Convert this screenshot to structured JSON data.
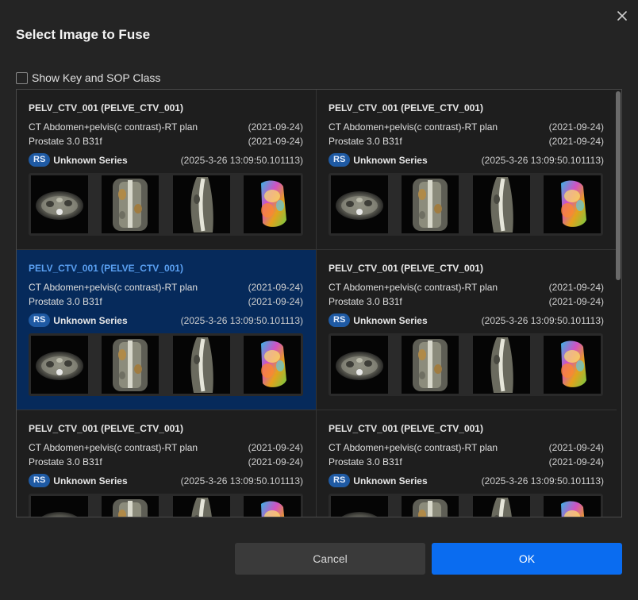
{
  "dialog": {
    "title": "Select Image to Fuse",
    "close_icon": "close-icon",
    "show_key_label": "Show Key and SOP Class",
    "show_key_checked": false
  },
  "cards": [
    {
      "title": "PELV_CTV_001 (PELVE_CTV_001)",
      "study": "CT Abdomen+pelvis(c contrast)-RT plan",
      "study_date": "(2021-09-24)",
      "series_desc": "Prostate 3.0 B31f",
      "series_date": "(2021-09-24)",
      "badge": "RS",
      "rs_series": "Unknown Series",
      "rs_date": "(2025-3-26 13:09:50.101113)",
      "selected": false
    },
    {
      "title": "PELV_CTV_001 (PELVE_CTV_001)",
      "study": "CT Abdomen+pelvis(c contrast)-RT plan",
      "study_date": "(2021-09-24)",
      "series_desc": "Prostate 3.0 B31f",
      "series_date": "(2021-09-24)",
      "badge": "RS",
      "rs_series": "Unknown Series",
      "rs_date": "(2025-3-26 13:09:50.101113)",
      "selected": false
    },
    {
      "title": "PELV_CTV_001 (PELVE_CTV_001)",
      "study": "CT Abdomen+pelvis(c contrast)-RT plan",
      "study_date": "(2021-09-24)",
      "series_desc": "Prostate 3.0 B31f",
      "series_date": "(2021-09-24)",
      "badge": "RS",
      "rs_series": "Unknown Series",
      "rs_date": "(2025-3-26 13:09:50.101113)",
      "selected": true
    },
    {
      "title": "PELV_CTV_001 (PELVE_CTV_001)",
      "study": "CT Abdomen+pelvis(c contrast)-RT plan",
      "study_date": "(2021-09-24)",
      "series_desc": "Prostate 3.0 B31f",
      "series_date": "(2021-09-24)",
      "badge": "RS",
      "rs_series": "Unknown Series",
      "rs_date": "(2025-3-26 13:09:50.101113)",
      "selected": false
    },
    {
      "title": "PELV_CTV_001 (PELVE_CTV_001)",
      "study": "CT Abdomen+pelvis(c contrast)-RT plan",
      "study_date": "(2021-09-24)",
      "series_desc": "Prostate 3.0 B31f",
      "series_date": "(2021-09-24)",
      "badge": "RS",
      "rs_series": "Unknown Series",
      "rs_date": "(2025-3-26 13:09:50.101113)",
      "selected": false
    },
    {
      "title": "PELV_CTV_001 (PELVE_CTV_001)",
      "study": "CT Abdomen+pelvis(c contrast)-RT plan",
      "study_date": "(2021-09-24)",
      "series_desc": "Prostate 3.0 B31f",
      "series_date": "(2021-09-24)",
      "badge": "RS",
      "rs_series": "Unknown Series",
      "rs_date": "(2025-3-26 13:09:50.101113)",
      "selected": false
    }
  ],
  "thumbnail_views": [
    "axial",
    "coronal",
    "sagittal",
    "3d-render"
  ],
  "buttons": {
    "cancel_label": "Cancel",
    "ok_label": "OK"
  },
  "colors": {
    "background": "#242424",
    "selected_card": "#062a5b",
    "selected_title": "#5aa0f2",
    "badge": "#1f5aa3",
    "ok_button": "#0a6cf0",
    "cancel_button": "#3a3a3a"
  }
}
